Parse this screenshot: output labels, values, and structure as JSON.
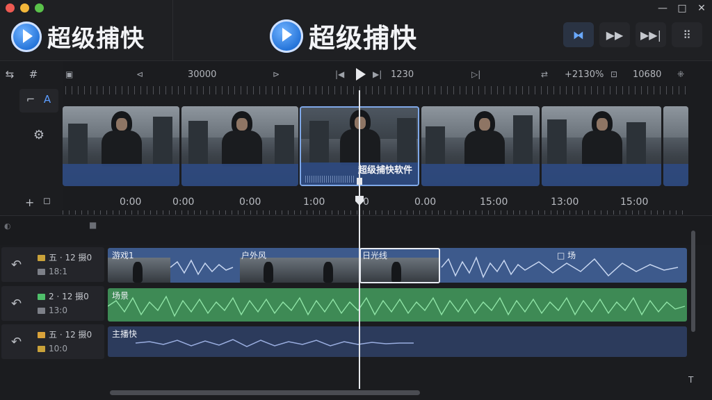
{
  "app": {
    "brand": "超级捕快"
  },
  "window": {
    "minimize": "—",
    "maximize": "□",
    "close": "✕"
  },
  "mode_buttons": [
    {
      "icon": "bowtie-icon",
      "glyph": "⧓",
      "active": true
    },
    {
      "icon": "fast-forward-icon",
      "glyph": "▶▶",
      "active": false
    },
    {
      "icon": "skip-to-end-icon",
      "glyph": "▶▶|",
      "active": false
    },
    {
      "icon": "grid-dots-icon",
      "glyph": "⠿",
      "active": false
    }
  ],
  "tools": {
    "hash": "#",
    "text_tool": "A",
    "settings": "⚙",
    "add": "+"
  },
  "top_ruler": {
    "left_time": "30000",
    "right_time": "1230",
    "zoom": "+2130%",
    "frame_count": "10680"
  },
  "filmstrip": {
    "caption": "超级捕快软件"
  },
  "timecodes": [
    "0:00",
    "0:00",
    "0:00",
    "1:00",
    "0",
    "0.00",
    "15:00",
    "13:00",
    "15:00"
  ],
  "tracks": [
    {
      "name": "五 · 12 摄0",
      "sub": "18:1",
      "swatch": "#c9a23a"
    },
    {
      "name": "2 · 12 摄0",
      "sub": "13:0",
      "swatch": "#4fbf6a"
    },
    {
      "name": "五 · 12 摄0",
      "sub": "10:0",
      "swatch": "#d9a23a"
    }
  ],
  "lanes": {
    "video": {
      "seg1": "游戏1",
      "seg2": "户外风",
      "seg3": "日光线",
      "seg4": "□ 场"
    },
    "green": {
      "label": "场景"
    },
    "voice": {
      "label": "主播快"
    }
  },
  "colors": {
    "accent": "#5c9dff",
    "video_lane": "#3d5a8c",
    "green_lane": "#3e8a55",
    "voice_lane": "#2c3b5c"
  }
}
